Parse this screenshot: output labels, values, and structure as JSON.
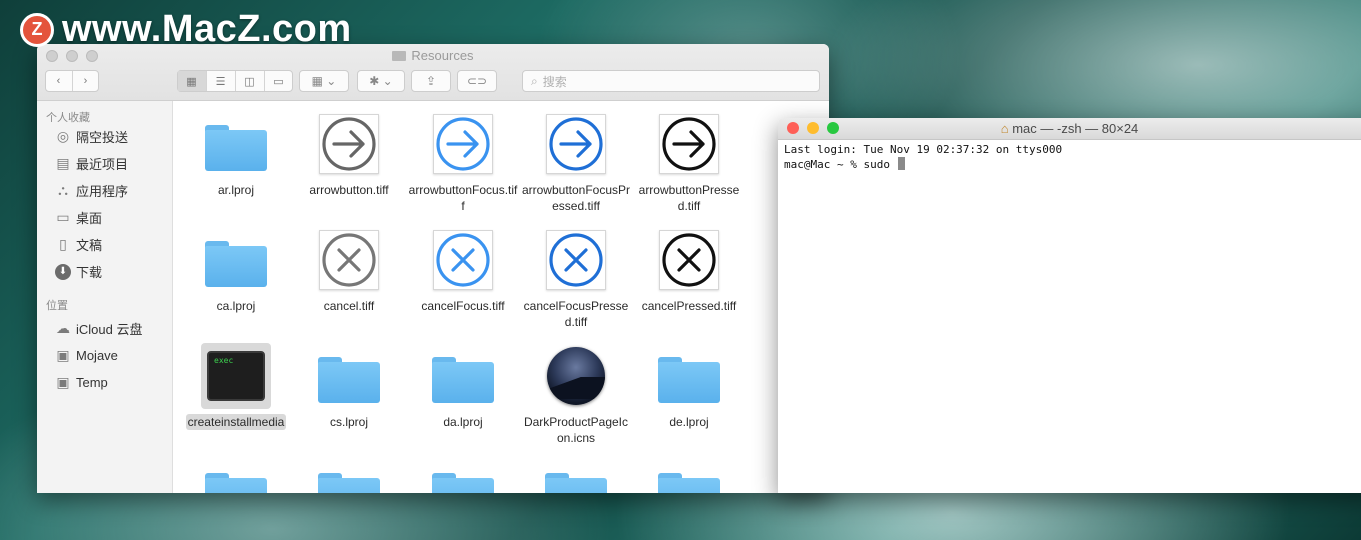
{
  "watermark": {
    "badge": "Z",
    "text": "www.MacZ.com"
  },
  "finder": {
    "title": "Resources",
    "search_placeholder": "搜索",
    "sidebar": {
      "favorites_header": "个人收藏",
      "favorites": [
        {
          "label": "隔空投送",
          "icon": "airdrop-icon"
        },
        {
          "label": "最近项目",
          "icon": "recents-icon"
        },
        {
          "label": "应用程序",
          "icon": "applications-icon"
        },
        {
          "label": "桌面",
          "icon": "desktop-icon"
        },
        {
          "label": "文稿",
          "icon": "documents-icon"
        },
        {
          "label": "下载",
          "icon": "downloads-icon"
        }
      ],
      "locations_header": "位置",
      "locations": [
        {
          "label": "iCloud 云盘",
          "icon": "icloud-icon"
        },
        {
          "label": "Mojave",
          "icon": "disk-icon"
        },
        {
          "label": "Temp",
          "icon": "disk-icon"
        }
      ]
    },
    "files": [
      {
        "name": "ar.lproj",
        "kind": "folder"
      },
      {
        "name": "arrowbutton.tiff",
        "kind": "arrow",
        "color": "#666666",
        "fill": "none"
      },
      {
        "name": "arrowbuttonFocus.tiff",
        "kind": "arrow",
        "color": "#3a93f0",
        "fill": "none"
      },
      {
        "name": "arrowbuttonFocusPressed.tiff",
        "kind": "arrow",
        "color": "#1f6fd6",
        "fill": "none"
      },
      {
        "name": "arrowbuttonPressed.tiff",
        "kind": "arrow",
        "color": "#111111",
        "fill": "none"
      },
      {
        "name": "ca.lproj",
        "kind": "folder"
      },
      {
        "name": "cancel.tiff",
        "kind": "cancel",
        "color": "#777777"
      },
      {
        "name": "cancelFocus.tiff",
        "kind": "cancel",
        "color": "#3a93f0"
      },
      {
        "name": "cancelFocusPressed.tiff",
        "kind": "cancel",
        "color": "#1f6fd6"
      },
      {
        "name": "cancelPressed.tiff",
        "kind": "cancel",
        "color": "#111111"
      },
      {
        "name": "createinstallmedia",
        "kind": "exec",
        "label": "exec",
        "selected": true
      },
      {
        "name": "cs.lproj",
        "kind": "folder"
      },
      {
        "name": "da.lproj",
        "kind": "folder"
      },
      {
        "name": "DarkProductPageIcon.icns",
        "kind": "disc"
      },
      {
        "name": "de.lproj",
        "kind": "folder"
      },
      {
        "name": "",
        "kind": "folder"
      },
      {
        "name": "",
        "kind": "folder"
      },
      {
        "name": "",
        "kind": "folder"
      },
      {
        "name": "",
        "kind": "folder"
      },
      {
        "name": "",
        "kind": "folder"
      }
    ]
  },
  "terminal": {
    "title": "mac — -zsh — 80×24",
    "lines": [
      "Last login: Tue Nov 19 02:37:32 on ttys000",
      "mac@Mac ~ % sudo "
    ]
  },
  "colors": {
    "red": "#fe5f57",
    "yellow": "#febc2e",
    "green": "#28c840"
  }
}
